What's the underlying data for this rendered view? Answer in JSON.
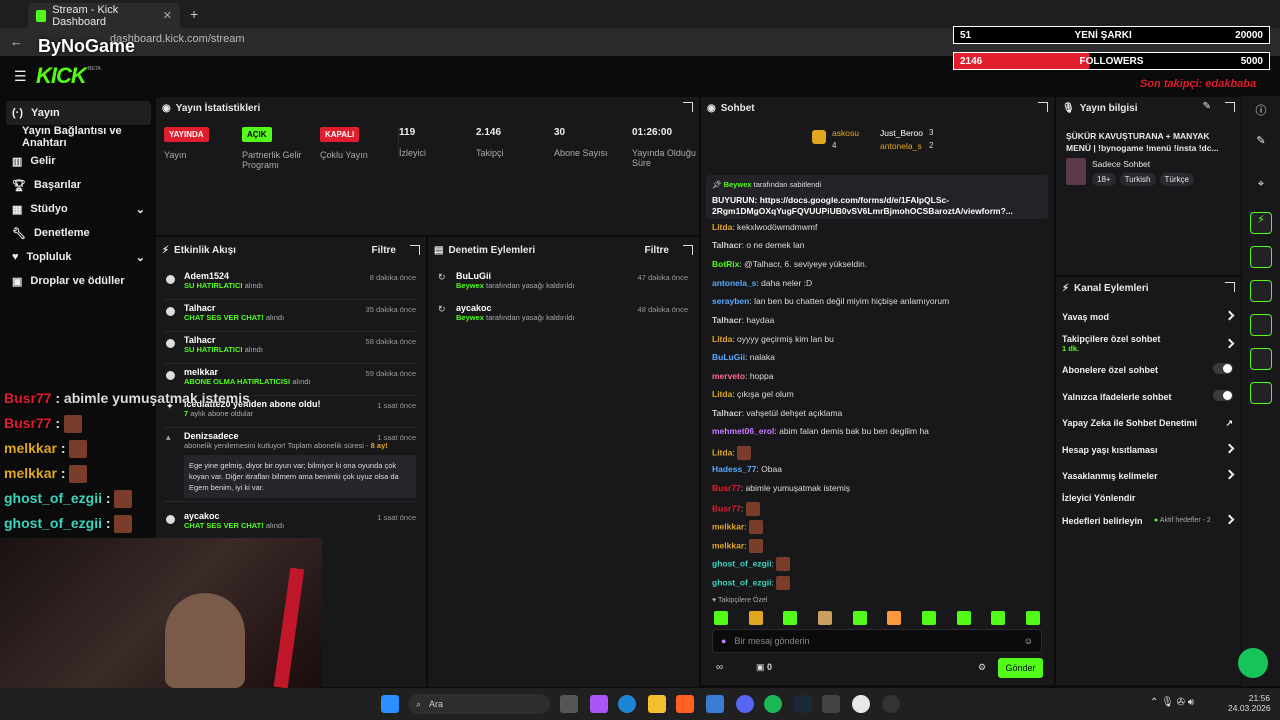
{
  "browser": {
    "tab_title": "Stream - Kick Dashboard",
    "url": "dashboard.kick.com/stream",
    "overlay_brand": "ByNoGame"
  },
  "kick": {
    "logo": "KICK",
    "beta": "BETA"
  },
  "sidebar": {
    "items": [
      {
        "label": "Yayın",
        "icon": "stream-icon"
      },
      {
        "label": "Yayın Bağlantısı ve Anahtarı"
      },
      {
        "label": "Gelir",
        "icon": "chart-icon"
      },
      {
        "label": "Başarılar",
        "icon": "trophy-icon"
      },
      {
        "label": "Stüdyo",
        "icon": "studio-icon"
      },
      {
        "label": "Denetleme",
        "icon": "wrench-icon"
      },
      {
        "label": "Topluluk",
        "icon": "community-icon"
      },
      {
        "label": "Droplar ve ödüller",
        "icon": "gift-icon"
      }
    ]
  },
  "stats": {
    "title": "Yayın İstatistikleri",
    "items": [
      {
        "badge": "YAYINDA",
        "label": "Yayın",
        "color": "#e01e2d"
      },
      {
        "badge": "AÇIK",
        "label": "Partnerlik Gelir Programı",
        "color": "#53fc18"
      },
      {
        "badge": "KAPALI",
        "label": "Çoklu Yayın",
        "color": "#e01e2d"
      },
      {
        "value": "119",
        "label": "İzleyici"
      },
      {
        "value": "2.146",
        "label": "Takipçi"
      },
      {
        "value": "30",
        "label": "Abone Sayısı"
      },
      {
        "value": "01:26:00",
        "label": "Yayında Olduğu Süre"
      }
    ]
  },
  "activity": {
    "title": "Etkinlik Akışı",
    "filter": "Filtre",
    "events": [
      {
        "name": "Adem1524",
        "action": "SU HATIRLATICI",
        "suffix": "alındı",
        "time": "8 dakika önce"
      },
      {
        "name": "Talhacr",
        "action": "CHAT SES VER CHAT!",
        "suffix": "alındı",
        "time": "35 dakika önce"
      },
      {
        "name": "Talhacr",
        "action": "SU HATIRLATICI",
        "suffix": "alındı",
        "time": "58 dakika önce"
      },
      {
        "name": "melkkar",
        "action": "ABONE OLMA HATIRLATICISI",
        "suffix": "alındı",
        "time": "59 dakika önce"
      },
      {
        "name": "icedlatte20 yeniden abone oldu!",
        "action": "7",
        "suffix": "aylık abone oldular",
        "time": "1 saat önce"
      },
      {
        "name": "Denizsadece",
        "action": "abonelik yenilemesini kutluyor! Toplam abonelik süresi -",
        "suffix": "8 ay!",
        "time": "1 saat önce",
        "message": "Ege yine gelmiş, diyor bir oyun var; bilmiyor ki ona oyunda çok koyan var. Diğer itirafları bilmem ama benimki çok uyuz olsa da Egem benim, iyi ki var."
      },
      {
        "name": "aycakoc",
        "action": "CHAT SES VER CHAT!",
        "suffix": "alındı",
        "time": "1 saat önce"
      }
    ]
  },
  "moderation": {
    "title": "Denetim Eylemleri",
    "filter": "Filtre",
    "events": [
      {
        "name": "BuLuGii",
        "by": "Beywex",
        "text": "tarafından yasağı kaldırıldı",
        "time": "47 dakika önce"
      },
      {
        "name": "aycakoc",
        "by": "Beywex",
        "text": "tarafından yasağı kaldırıldı",
        "time": "48 dakika önce"
      }
    ]
  },
  "chat": {
    "title": "Sohbet",
    "top": [
      {
        "name": "askosu",
        "count": "4"
      },
      {
        "name": "Just_Beroo",
        "count": "3"
      },
      {
        "name": "antonela_s",
        "count": "2"
      }
    ],
    "pinned_by": "Beywex",
    "pinned_suffix": "tarafından sabitlendi",
    "pinned_text": "BUYURUN: https://docs.google.com/forms/d/e/1FAIpQLSc-2Rgm1DMgOXqYugFQVUUPiUB0vSV6LmrBjmohOCSBaroztA/viewform?...",
    "messages": [
      {
        "user": "Litda",
        "color": "#e0a821",
        "text": "kekxlwodöwmdmwmf"
      },
      {
        "user": "Talhacr",
        "color": "#cfcfcf",
        "text": "o ne demek lan"
      },
      {
        "user": "BotRix",
        "color": "#53fc18",
        "text": "@Talhacr, 6. seviyeye yükseldin."
      },
      {
        "user": "antonela_s",
        "color": "#5aa9ff",
        "text": "daha neler :D"
      },
      {
        "user": "serayben",
        "color": "#5aa9ff",
        "text": "lan ben bu chatten değil miyim hiçbişe anlamıyorum"
      },
      {
        "user": "Talhacr",
        "color": "#cfcfcf",
        "text": "haydaa"
      },
      {
        "user": "Litda",
        "color": "#e0a821",
        "text": "oyyyy geçirmiş kim lan bu"
      },
      {
        "user": "BuLuGii",
        "color": "#5aa9ff",
        "text": "nalaka"
      },
      {
        "user": "merveto",
        "color": "#ff6b8b",
        "text": "hoppa"
      },
      {
        "user": "Litda",
        "color": "#e0a821",
        "text": "çıkışa gel olum"
      },
      {
        "user": "Talhacr",
        "color": "#cfcfcf",
        "text": "vahşetül dehşet açıklama"
      },
      {
        "user": "mehmet06_erol",
        "color": "#c77dff",
        "text": "abim falan demis bak bu ben degilim ha"
      },
      {
        "user": "Litda",
        "color": "#e0a821",
        "text": ""
      },
      {
        "user": "Hadess_77",
        "color": "#5aa9ff",
        "text": "Obaa"
      },
      {
        "user": "Busr77",
        "color": "#e01e2d",
        "text": "abimle yumuşatmak istemiş"
      },
      {
        "user": "Busr77",
        "color": "#e01e2d",
        "text": ""
      },
      {
        "user": "melkkar",
        "color": "#e0a821",
        "text": ""
      },
      {
        "user": "melkkar",
        "color": "#e0a821",
        "text": ""
      },
      {
        "user": "ghost_of_ezgii",
        "color": "#3ad6c0",
        "text": ""
      },
      {
        "user": "ghost_of_ezgii",
        "color": "#3ad6c0",
        "text": ""
      }
    ],
    "followers_only": "Takipçilere Özel",
    "placeholder": "Bir mesaj gönderin",
    "send": "Gönder",
    "points": "0"
  },
  "stream_info": {
    "title": "Yayın bilgisi",
    "stream_title": "ŞÜKÜR KAVUŞTURANA + MANYAK MENÜ | !bynogame !menü !insta !dc...",
    "category": "Sadece Sohbet",
    "tags": [
      "18+",
      "Turkish",
      "Türkçe"
    ]
  },
  "channel_actions": {
    "title": "Kanal Eylemleri",
    "items": [
      {
        "label": "Yavaş mod",
        "type": "arrow"
      },
      {
        "label": "Takipçilere özel sohbet",
        "sub": "1 dk.",
        "type": "arrow"
      },
      {
        "label": "Abonelere özel sohbet",
        "type": "toggle"
      },
      {
        "label": "Yalnızca ifadelerle sohbet",
        "type": "toggle"
      },
      {
        "label": "Yapay Zeka ile Sohbet Denetimi",
        "type": "link"
      },
      {
        "label": "Hesap yaşı kısıtlaması",
        "type": "arrow"
      },
      {
        "label": "Yasaklanmış kelimeler",
        "type": "arrow"
      },
      {
        "label": "İzleyici Yönlendir",
        "type": "none"
      },
      {
        "label": "Hedefleri belirleyin",
        "sub": "Aktif hedefler - 2",
        "type": "arrow"
      }
    ]
  },
  "overlay": {
    "goal1_left": "51",
    "goal1_label": "YENİ ŞARKI",
    "goal1_right": "20000",
    "goal2_left": "2146",
    "goal2_label": "FOLLOWERS",
    "goal2_right": "5000",
    "goal2_progress": 0.43,
    "last_follower": "Son takipçi: edakbaba",
    "chat": [
      {
        "user": "Busr77",
        "text": "abimle yumuşatmak istemiş",
        "color": "#e01e2d"
      },
      {
        "user": "Busr77",
        "text": "",
        "color": "#e01e2d"
      },
      {
        "user": "melkkar",
        "text": "",
        "color": "#e0a821"
      },
      {
        "user": "melkkar",
        "text": "",
        "color": "#e0a821"
      },
      {
        "user": "ghost_of_ezgii",
        "text": "",
        "color": "#3ad6c0"
      },
      {
        "user": "ghost_of_ezgii",
        "text": "",
        "color": "#3ad6c0"
      }
    ]
  },
  "taskbar": {
    "search": "Ara",
    "time": "21:56",
    "date": "24.03.2026"
  }
}
